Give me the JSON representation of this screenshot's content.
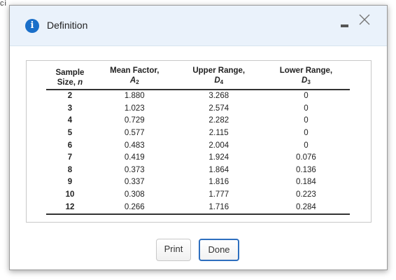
{
  "background": {
    "partial_text": "ci"
  },
  "dialog": {
    "title": "Definition",
    "icons": {
      "info": "info-icon",
      "minimize": "minimize-icon",
      "close": "close-icon"
    },
    "accent_color": "#1a6fc9"
  },
  "table": {
    "headers": [
      {
        "line1": "Sample",
        "line2": "Size, ",
        "line2_italic": "n",
        "sub": ""
      },
      {
        "line1": "Mean Factor,",
        "line2": "",
        "line2_italic": "A",
        "sub": "2"
      },
      {
        "line1": "Upper Range,",
        "line2": "",
        "line2_italic": "D",
        "sub": "4"
      },
      {
        "line1": "Lower Range,",
        "line2": "",
        "line2_italic": "D",
        "sub": "3"
      }
    ],
    "rows": [
      [
        "2",
        "1.880",
        "3.268",
        "0"
      ],
      [
        "3",
        "1.023",
        "2.574",
        "0"
      ],
      [
        "4",
        "0.729",
        "2.282",
        "0"
      ],
      [
        "5",
        "0.577",
        "2.115",
        "0"
      ],
      [
        "6",
        "0.483",
        "2.004",
        "0"
      ],
      [
        "7",
        "0.419",
        "1.924",
        "0.076"
      ],
      [
        "8",
        "0.373",
        "1.864",
        "0.136"
      ],
      [
        "9",
        "0.337",
        "1.816",
        "0.184"
      ],
      [
        "10",
        "0.308",
        "1.777",
        "0.223"
      ],
      [
        "12",
        "0.266",
        "1.716",
        "0.284"
      ]
    ]
  },
  "buttons": {
    "print_label": "Print",
    "done_label": "Done"
  }
}
